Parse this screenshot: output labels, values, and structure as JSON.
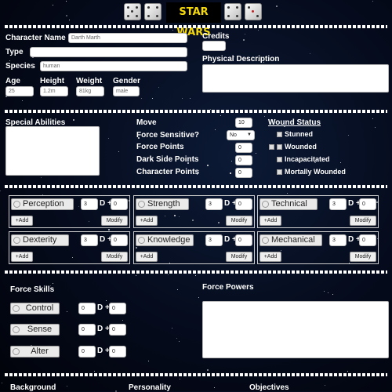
{
  "header": {
    "logo_text": "STAR WARS",
    "dice_left": [
      "die-icon",
      "die-icon"
    ],
    "dice_right": [
      "die-icon",
      "die-icon"
    ]
  },
  "character": {
    "name_label": "Character Name",
    "name_value": "Darth Marth",
    "type_label": "Type",
    "type_value": "",
    "species_label": "Species",
    "species_value": "human",
    "age_label": "Age",
    "age_value": "25",
    "height_label": "Height",
    "height_value": "1.2m",
    "weight_label": "Weight",
    "weight_value": "81kg",
    "gender_label": "Gender",
    "gender_value": "male",
    "credits_label": "Credits",
    "credits_value": "",
    "physical_label": "Physical Description",
    "physical_value": ""
  },
  "abilities": {
    "special_label": "Special Abilities",
    "move_label": "Move",
    "move_value": "10",
    "force_sensitive_label": "Force Sensitive?",
    "force_sensitive_value": "No",
    "force_points_label": "Force Points",
    "force_points_value": "0",
    "dark_side_label": "Dark Side Points",
    "dark_side_value": "0",
    "character_points_label": "Character Points",
    "character_points_value": "0"
  },
  "wounds": {
    "title": "Wound Status",
    "items": [
      "Stunned",
      "Wounded",
      "Incapacitated",
      "Mortally Wounded"
    ]
  },
  "attributes": [
    {
      "name": "Perception",
      "dice": "3",
      "pips": "0",
      "add": "+Add",
      "modify": "Modify"
    },
    {
      "name": "Strength",
      "dice": "3",
      "pips": "0",
      "add": "+Add",
      "modify": "Modify"
    },
    {
      "name": "Technical",
      "dice": "3",
      "pips": "0",
      "add": "+Add",
      "modify": "Modify"
    },
    {
      "name": "Dexterity",
      "dice": "3",
      "pips": "0",
      "add": "+Add",
      "modify": "Modify"
    },
    {
      "name": "Knowledge",
      "dice": "3",
      "pips": "0",
      "add": "+Add",
      "modify": "Modify"
    },
    {
      "name": "Mechanical",
      "dice": "3",
      "pips": "0",
      "add": "+Add",
      "modify": "Modify"
    }
  ],
  "d_plus": "D +",
  "force": {
    "skills_label": "Force Skills",
    "skills": [
      {
        "name": "Control",
        "dice": "0",
        "pips": "0"
      },
      {
        "name": "Sense",
        "dice": "0",
        "pips": "0"
      },
      {
        "name": "Alter",
        "dice": "0",
        "pips": "0"
      }
    ],
    "powers_label": "Force Powers"
  },
  "footer": {
    "background_label": "Background",
    "personality_label": "Personality",
    "objectives_label": "Objectives"
  }
}
